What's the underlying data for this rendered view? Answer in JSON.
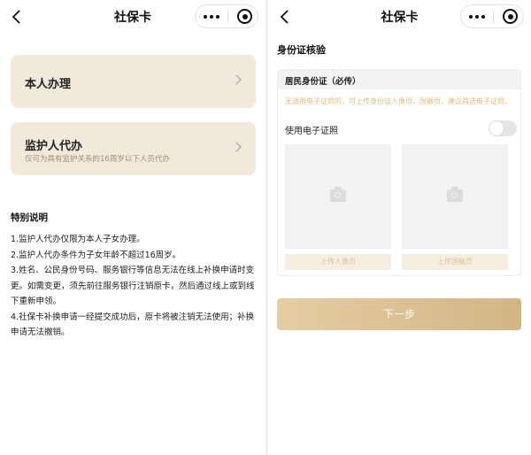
{
  "left": {
    "nav": {
      "title": "社保卡"
    },
    "cards": [
      {
        "title": "本人办理",
        "subtitle": ""
      },
      {
        "title": "监护人代办",
        "subtitle": "仅可为具有监护关系的16周岁以下人员代办"
      }
    ],
    "notes": {
      "title": "特别说明",
      "items": [
        "1.监护人代办仅限为本人子女办理。",
        "2.监护人代办条件为子女年龄不超过16周岁。",
        "3.姓名、公民身份号码、服务银行等信息无法在线上补换申请时变更。如需变更，须先前往服务银行注销原卡，然后通过线上或到线下重新申领。",
        "4.社保卡补换申请一经提交成功后，原卡将被注销无法使用；补换申请无法撤销。"
      ]
    }
  },
  "right": {
    "nav": {
      "title": "社保卡"
    },
    "section_title": "身份证核验",
    "id_card": {
      "header": "居民身份证（必传）",
      "hint": "无调用电子证照的，可上传身份证人像页，国徽页，建议首选电子证照。",
      "toggle_label": "使用电子证照",
      "toggle_on": false,
      "upload_portrait": "上传人像页",
      "upload_emblem": "上传国徽页"
    },
    "next_button": "下一步"
  },
  "colors": {
    "card_bg": "#f1eadc",
    "hint_text": "#e0b97c",
    "next_button": "#d9bd8f"
  },
  "icons": [
    "back-icon",
    "more-icon",
    "close-circle-icon",
    "chevron-right-icon",
    "camera-icon"
  ]
}
